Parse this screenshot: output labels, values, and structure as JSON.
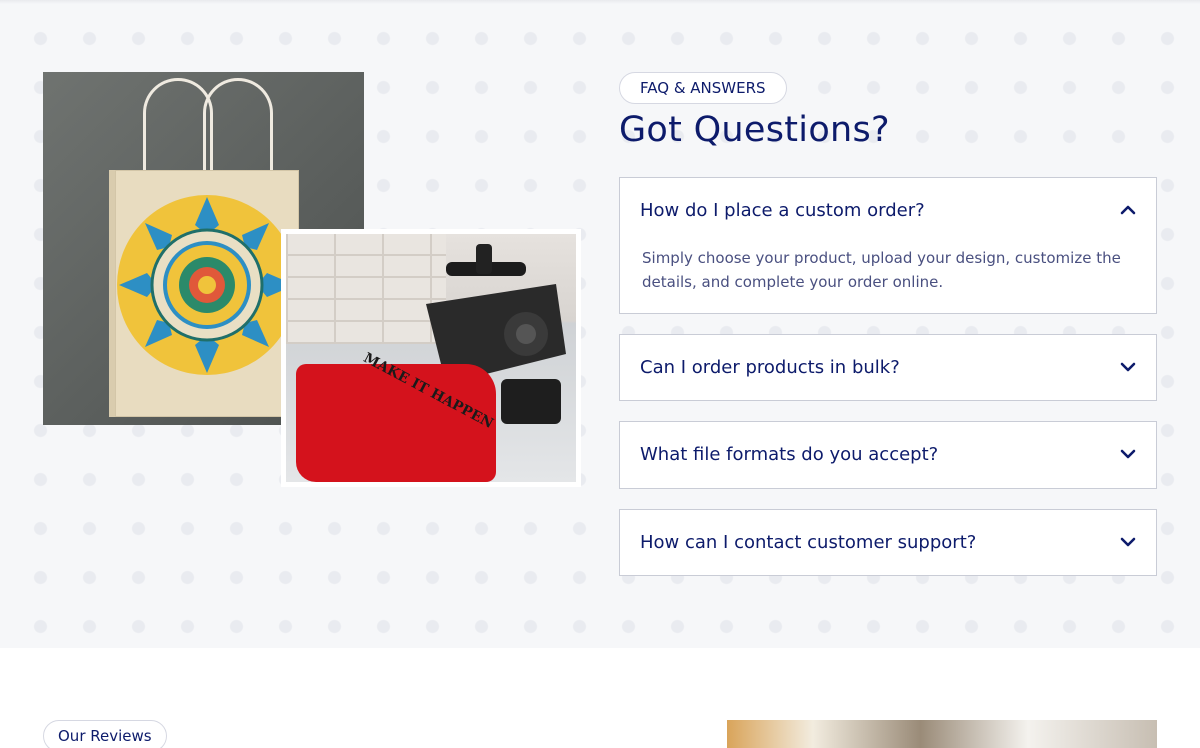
{
  "faq": {
    "badge": "FAQ & ANSWERS",
    "title": "Got Questions?",
    "items": [
      {
        "question": "How do I place a custom order?",
        "answer": "Simply choose your product, upload your design, customize the details, and complete your order online.",
        "expanded": true
      },
      {
        "question": "Can I order products in bulk?",
        "expanded": false
      },
      {
        "question": "What file formats do you accept?",
        "expanded": false
      },
      {
        "question": "How can I contact customer support?",
        "expanded": false
      }
    ]
  },
  "images": {
    "bag_icon": "mandala-paper-bag-photo",
    "press_icon": "heat-press-tshirt-photo",
    "shirt_print": "MAKE IT HAPPEN"
  },
  "reviews": {
    "badge": "Our Reviews"
  },
  "colors": {
    "primary": "#0d1b6b",
    "section_bg": "#f6f7f9",
    "border": "#c9ccd6"
  }
}
